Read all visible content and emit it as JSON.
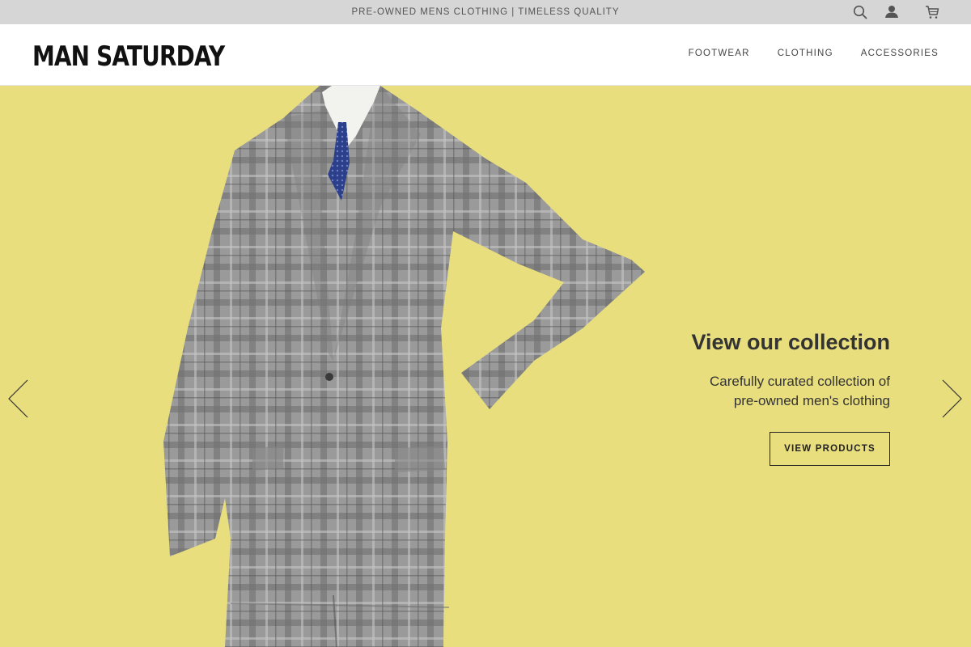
{
  "announcement": {
    "text": "PRE-OWNED MENS CLOTHING | TIMELESS QUALITY"
  },
  "header_icons": [
    "search-icon",
    "account-icon",
    "cart-icon"
  ],
  "logo": {
    "text": "MAN SATURDAY"
  },
  "nav": {
    "items": [
      {
        "label": "FOOTWEAR"
      },
      {
        "label": "CLOTHING"
      },
      {
        "label": "ACCESSORIES"
      }
    ]
  },
  "hero": {
    "title": "View our collection",
    "subtitle_lines": [
      "Carefully curated collection of",
      "pre-owned men's clothing"
    ],
    "button_label": "VIEW PRODUCTS",
    "background_color": "#e8de7e"
  },
  "carousel": {
    "prev_icon": "chevron-left-icon",
    "next_icon": "chevron-right-icon"
  }
}
